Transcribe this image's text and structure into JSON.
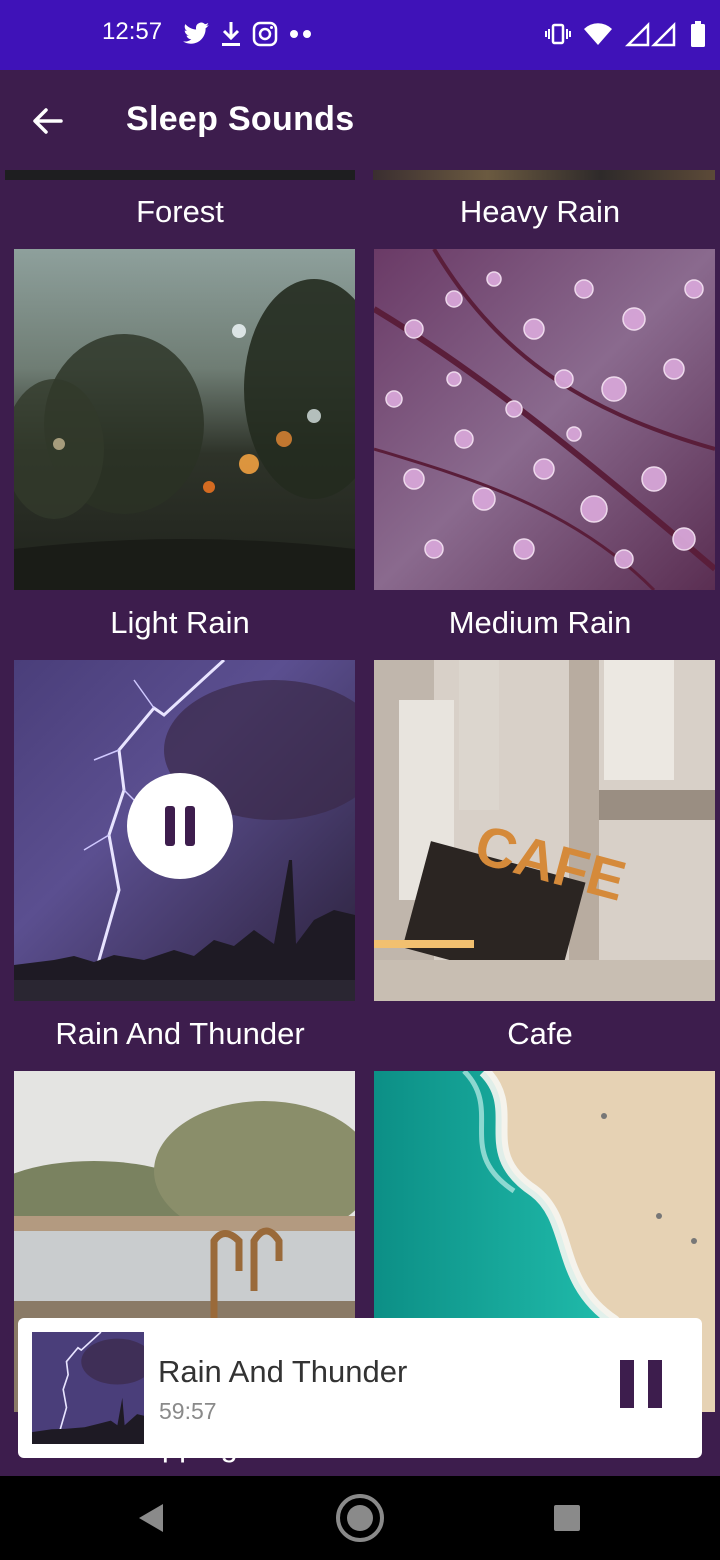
{
  "status_bar": {
    "time": "12:57",
    "left_icons": [
      "twitter-icon",
      "download-icon",
      "instagram-icon",
      "more-dots-icon"
    ],
    "right_icons": [
      "vibrate-icon",
      "wifi-icon",
      "signal-icon",
      "battery-icon"
    ]
  },
  "app_bar": {
    "title": "Sleep Sounds",
    "back_icon": "arrow-left-icon"
  },
  "sounds": [
    {
      "label": "Forest"
    },
    {
      "label": "Heavy Rain"
    },
    {
      "label": "Light Rain"
    },
    {
      "label": "Medium Rain"
    },
    {
      "label": "Rain And Thunder",
      "playing": true
    },
    {
      "label": "Cafe"
    },
    {
      "label": "Dripping"
    },
    {
      "label": ""
    }
  ],
  "tile_overlay_icon": "pause-icon",
  "now_playing": {
    "title": "Rain And Thunder",
    "elapsed": "59:57",
    "control_icon": "pause-icon"
  },
  "nav_bar": {
    "icons": [
      "back-triangle-icon",
      "home-circle-icon",
      "recents-square-icon"
    ]
  },
  "colors": {
    "status_bar": "#3f12b8",
    "background": "#3d1d4d",
    "accent": "#3d1d4d",
    "card": "#ffffff"
  }
}
